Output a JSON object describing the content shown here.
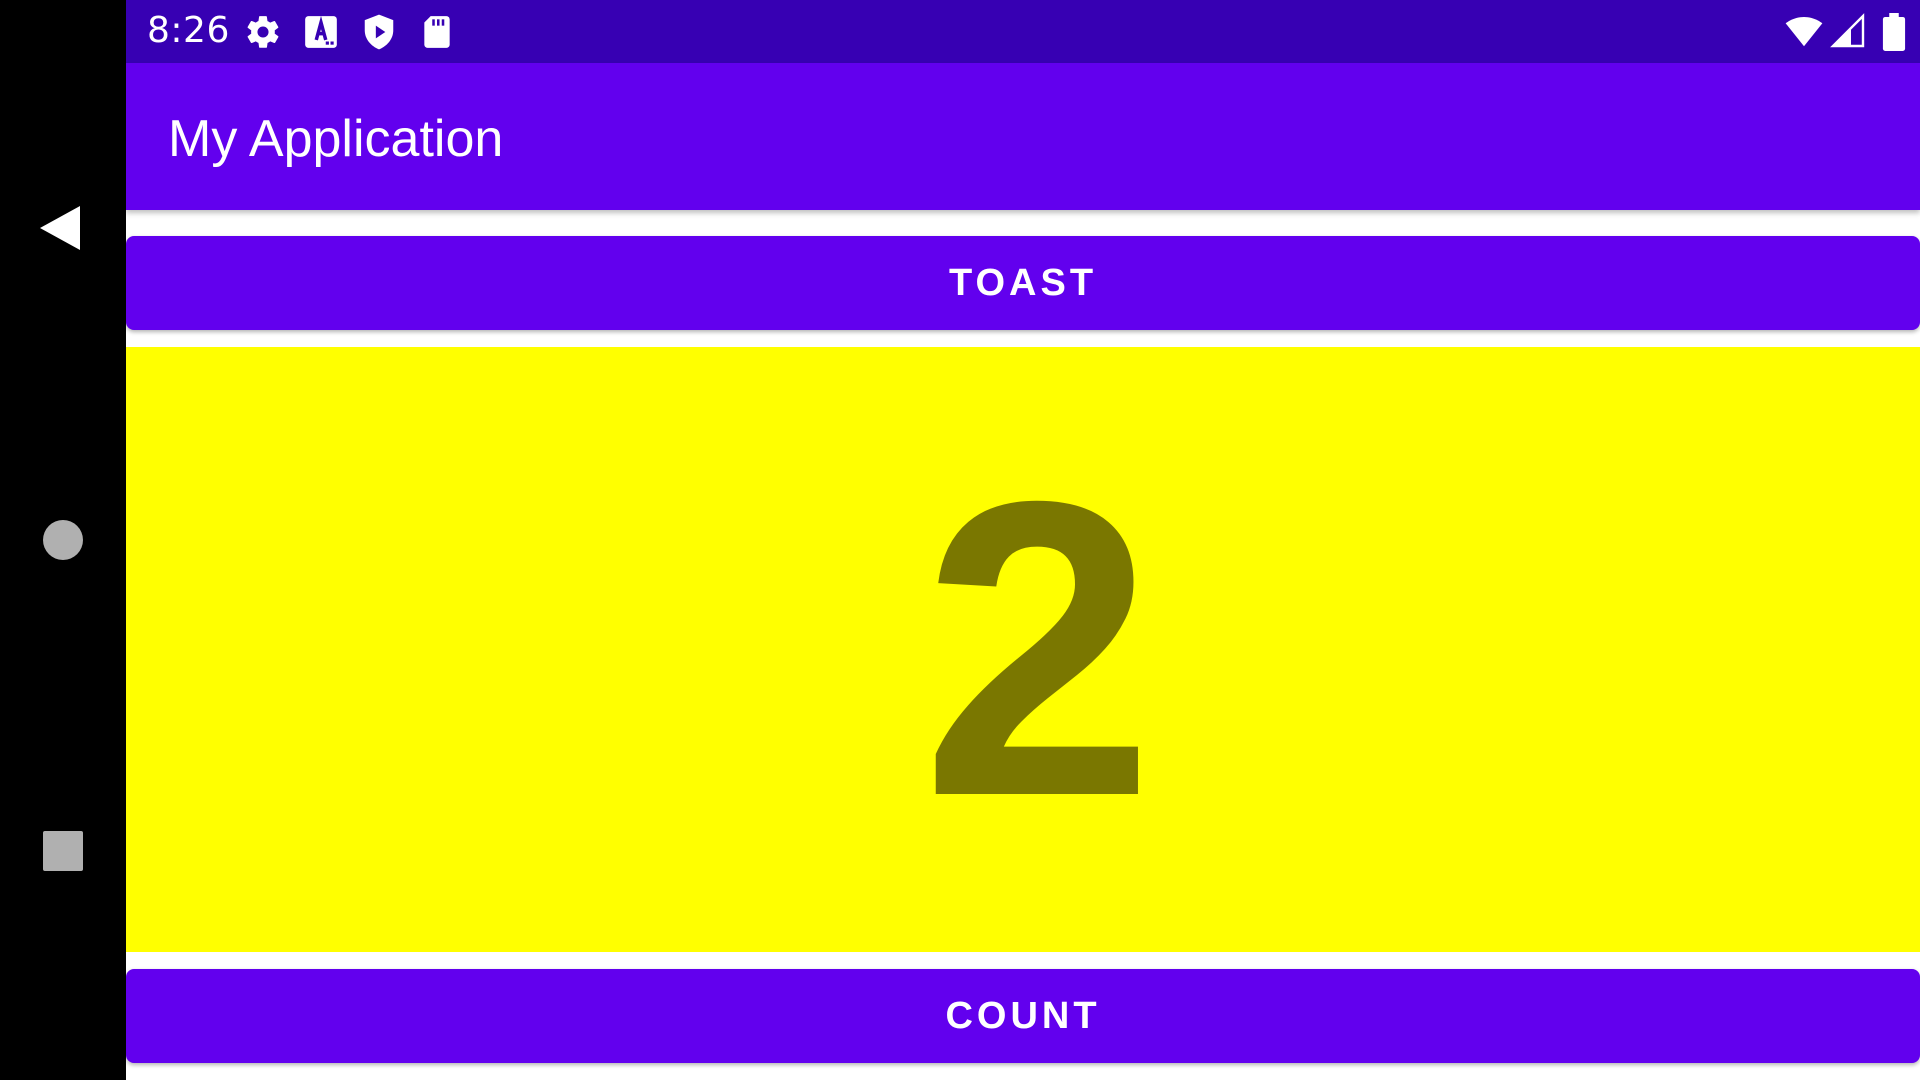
{
  "status_bar": {
    "time": "8:26",
    "left_icons": [
      "gear-icon",
      "font-a-icon",
      "shield-play-icon",
      "sd-card-icon"
    ],
    "right_icons": [
      "wifi-icon",
      "cell-signal-icon",
      "battery-icon"
    ],
    "background": "#3700b3"
  },
  "app_bar": {
    "title": "My Application",
    "background": "#6200ee"
  },
  "main": {
    "toast_button_label": "TOAST",
    "count_value": "2",
    "count_button_label": "COUNT",
    "count_panel_background": "#ffff00",
    "count_text_color": "#7a7700"
  },
  "nav_bar": {
    "buttons": [
      "back-icon",
      "home-icon",
      "recents-icon"
    ]
  }
}
